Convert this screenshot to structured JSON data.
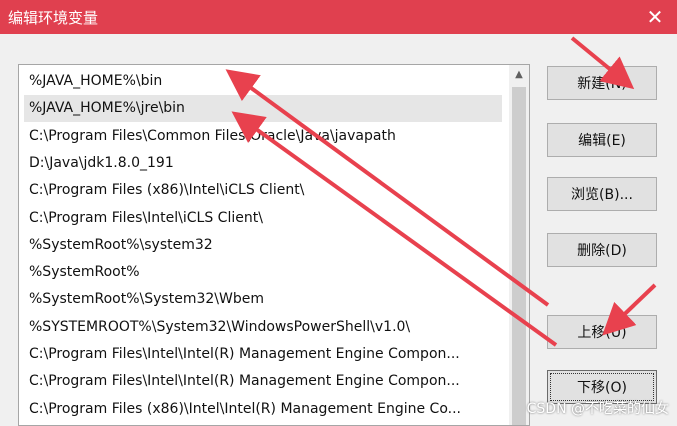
{
  "window": {
    "title": "编辑环境变量",
    "close_glyph": "✕"
  },
  "list": {
    "items": [
      "%JAVA_HOME%\\bin",
      "%JAVA_HOME%\\jre\\bin",
      "C:\\Program Files\\Common Files\\Oracle\\Java\\javapath",
      "D:\\Java\\jdk1.8.0_191",
      "C:\\Program Files (x86)\\Intel\\iCLS Client\\",
      "C:\\Program Files\\Intel\\iCLS Client\\",
      "%SystemRoot%\\system32",
      "%SystemRoot%",
      "%SystemRoot%\\System32\\Wbem",
      "%SYSTEMROOT%\\System32\\WindowsPowerShell\\v1.0\\",
      "C:\\Program Files\\Intel\\Intel(R) Management Engine Compon...",
      "C:\\Program Files\\Intel\\Intel(R) Management Engine Compon...",
      "C:\\Program Files (x86)\\Intel\\Intel(R) Management Engine Co..."
    ],
    "selected_index": 1
  },
  "buttons": {
    "new": "新建(N)",
    "edit": "编辑(E)",
    "browse": "浏览(B)...",
    "delete": "删除(D)",
    "move_up": "上移(U)",
    "move_down": "下移(O)"
  },
  "watermark": "CSDN @不吃菜的仙女",
  "colors": {
    "titlebar": "#e0404f",
    "arrow": "#e8414e"
  }
}
